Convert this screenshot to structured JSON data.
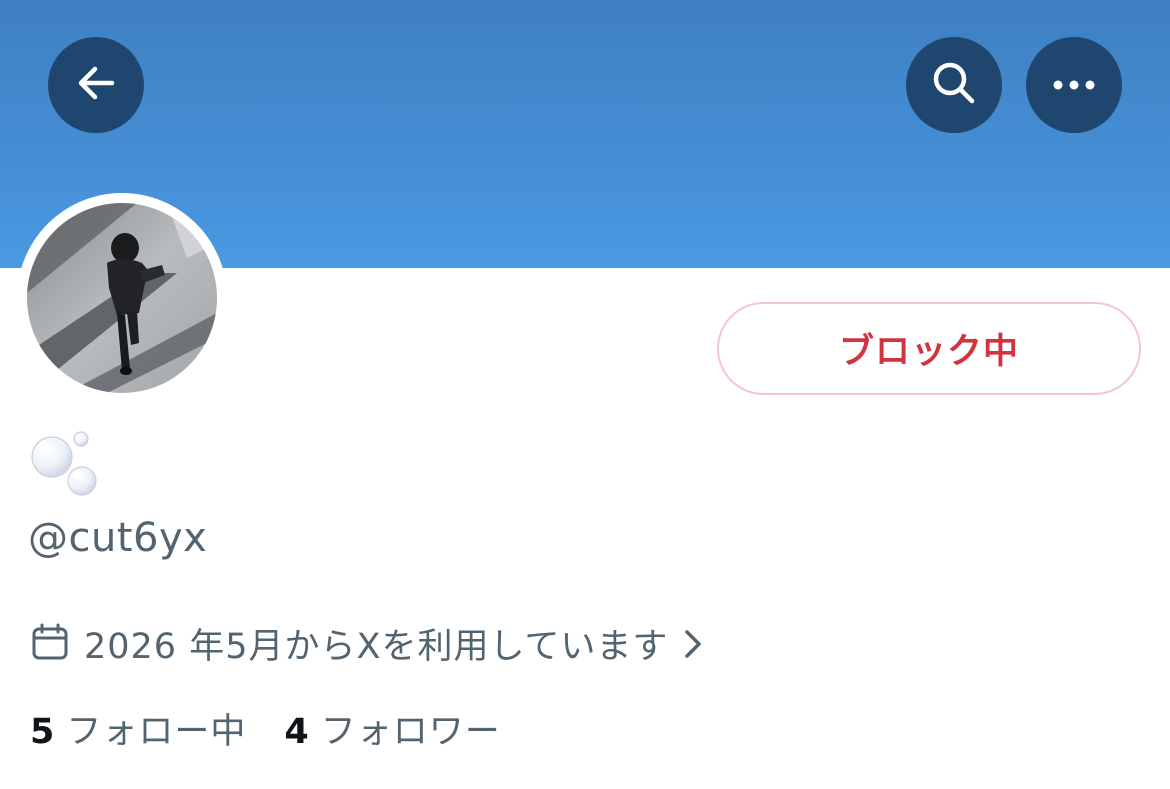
{
  "header": {
    "banner_color": "#4a99e2",
    "button_color": "#1e466e",
    "back_icon": "arrow-left-icon",
    "search_icon": "search-icon",
    "more_icon": "more-dots-icon"
  },
  "profile": {
    "avatar_icon": "avatar-photo",
    "display_name_icon": "bubbles-emoji",
    "username": "@cut6yx",
    "joined_icon": "calendar-icon",
    "joined_text": "2026 年5月からXを利用しています",
    "joined_chevron_icon": "chevron-right-icon"
  },
  "actions": {
    "block_label": "ブロック中",
    "block_color": "#d0353f"
  },
  "stats": {
    "following_count": "5",
    "following_label": "フォロー中",
    "followers_count": "4",
    "followers_label": "フォロワー"
  }
}
